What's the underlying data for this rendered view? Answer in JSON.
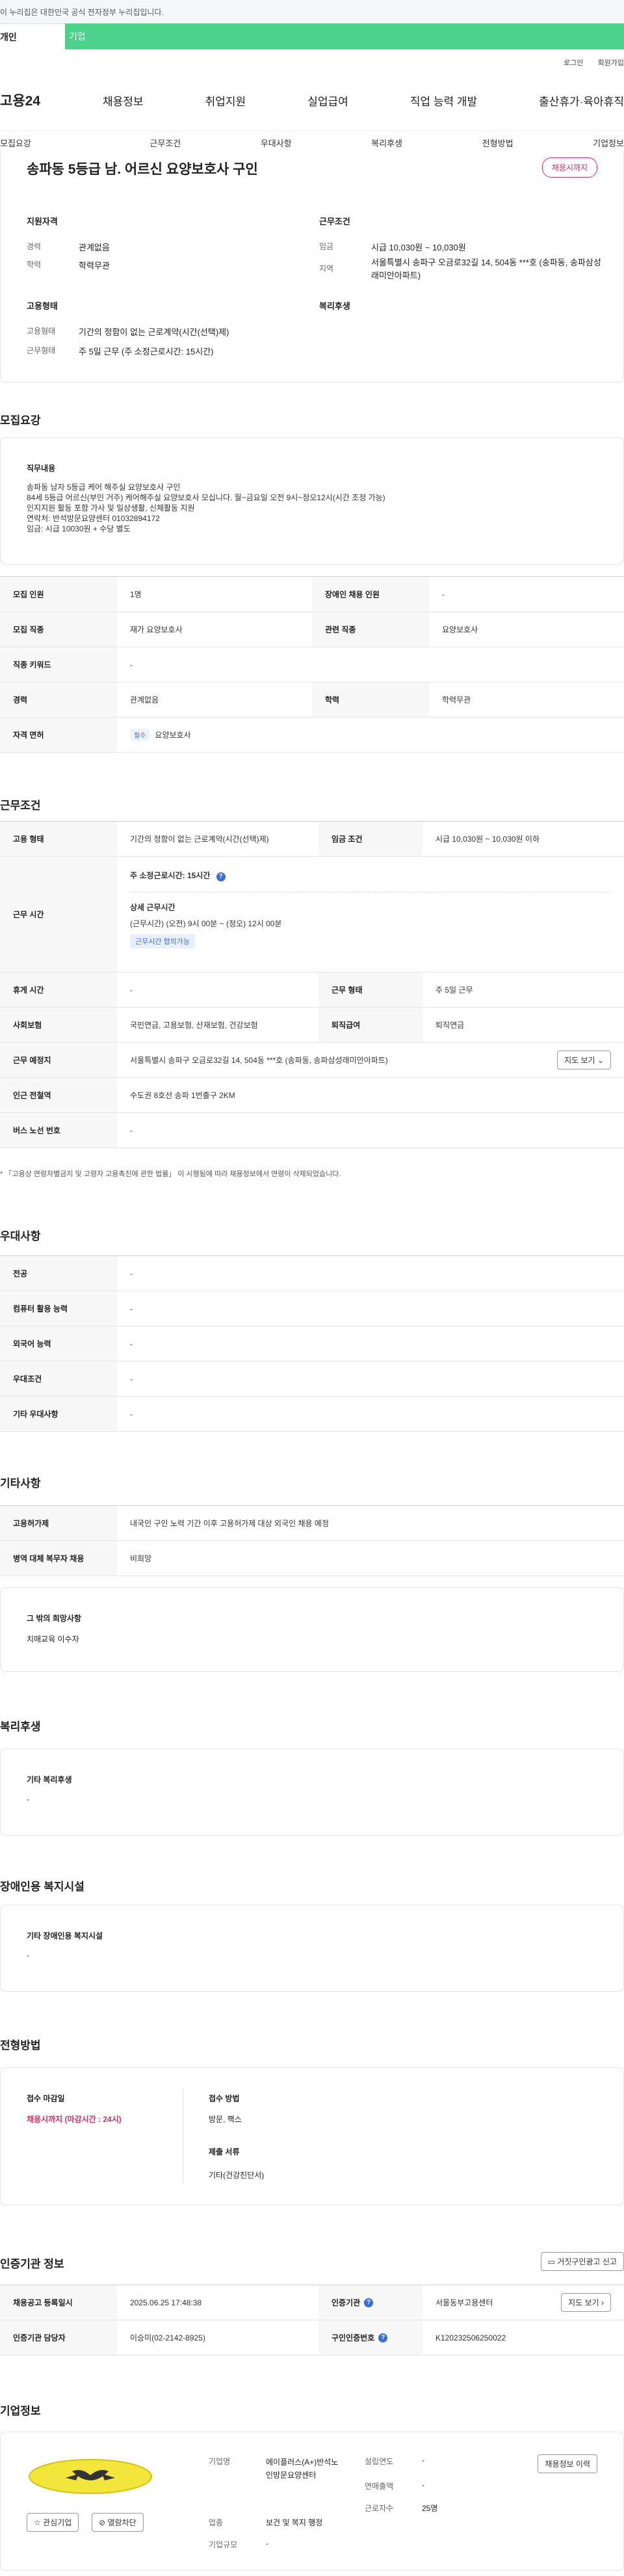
{
  "gov_notice": "이 누리집은 대한민국 공식 전자정부 누리집입니다.",
  "type_tabs": {
    "person": "개인",
    "company": "기업"
  },
  "top_links": [
    "로그인",
    "회원가입"
  ],
  "logo": "고용24",
  "main_menu": [
    "채용정보",
    "취업지원",
    "실업급여",
    "직업 능력 개발",
    "출산휴가·육아휴직"
  ],
  "sub_nav": [
    "모집요강",
    "근무조건",
    "우대사항",
    "복리후생",
    "전형방법",
    "기업정보"
  ],
  "job_title": "송파동 5등급 남. 어르신 요양보호사 구인",
  "status_badge": "채용시까지",
  "summary": {
    "qual_title": "지원자격",
    "career_label": "경력",
    "career_value": "관계없음",
    "edu_label": "학력",
    "edu_value": "학력무관",
    "work_title": "근무조건",
    "wage_label": "임금",
    "wage_value": "시급 10,030원 ~ 10,030원",
    "area_label": "지역",
    "area_value": "서울특별시 송파구 오금로32길 14, 504동 ***호 (송파동, 송파삼성래미안아파트)",
    "emp_title": "고용형태",
    "emp_type_label": "고용형태",
    "emp_type_value": "기간의 정함이 없는 근로계약(시간(선택)제)",
    "emp_form_label": "근무형태",
    "emp_form_value": "주 5일 근무 (주 소정근로시간: 15시간)",
    "welfare_title": "복리후생"
  },
  "recruit": {
    "title": "모집요강",
    "duty_title": "직무내용",
    "duty_lines": [
      "송파동 남자 5등급 케어 해주실 요양보호사 구인",
      "84세 5등급 어르신(부인 거주) 케어해주실 요양보호사 모십니다. 월~금요일 오전 9시~정오12시(시간 조정 가능)",
      "인지지원 활동 포함 가사 및 일상생활, 신체활동 지원",
      "연락처: 반석방문요양센터 01032894172",
      "임금: 시급 10030원 + 수당 별도"
    ],
    "rows": [
      {
        "l1": "모집 인원",
        "v1": "1명",
        "l2": "장애인 채용 인원",
        "v2": "-"
      },
      {
        "l1": "모집 직종",
        "v1": "재가 요양보호사",
        "l2": "관련 직종",
        "v2": "요양보호사"
      },
      {
        "l1": "직종 키워드",
        "v1": "-"
      },
      {
        "l1": "경력",
        "v1": "관계없음",
        "l2": "학력",
        "v2": "학력무관"
      }
    ],
    "license_label": "자격 면허",
    "license_tag": "필수",
    "license_value": "요양보호사"
  },
  "conditions": {
    "title": "근무조건",
    "emp_label": "고용 형태",
    "emp_value": "기간의 정함이 없는 근로계약(시간(선택)제)",
    "wage_label": "임금 조건",
    "wage_value": "시급 10,030원 ~ 10,030원 이하",
    "hours_label": "근무 시간",
    "weekly_hours": "주 소정근로시간: 15시간",
    "detail_title": "상세 근무시간",
    "detail_value": "(근무시간) (오전) 9시 00분 ~ (정오) 12시 00분",
    "negotiable_tag": "근무시간 협의가능",
    "rest_label": "휴게 시간",
    "rest_value": "-",
    "form_label": "근무 형태",
    "form_value": "주 5일 근무",
    "insurance_label": "사회보험",
    "insurance_value": "국민연금, 고용보험, 산재보험, 건강보험",
    "retire_label": "퇴직급여",
    "retire_value": "퇴직연금",
    "place_label": "근무 예정지",
    "place_value": "서울특별시 송파구 오금로32길 14, 504동 ***호 (송파동, 송파삼성래미안아파트)",
    "map_button": "지도 보기",
    "subway_label": "인근 전철역",
    "subway_value": "수도권 8호선 송파 1번출구 2KM",
    "bus_label": "버스 노선 번호",
    "bus_value": "-",
    "footnote": "* 「고용상 연령차별금지 및 고령자 고용촉진에 관한 법률」 이 시행됨에 따라 채용정보에서 연령이 삭제되었습니다."
  },
  "preference": {
    "title": "우대사항",
    "rows": [
      {
        "label": "전공",
        "value": "-"
      },
      {
        "label": "컴퓨터 활용 능력",
        "value": "-"
      },
      {
        "label": "외국어 능력",
        "value": "-"
      },
      {
        "label": "우대조건",
        "value": "-"
      },
      {
        "label": "기타 우대사항",
        "value": "-"
      }
    ]
  },
  "others": {
    "title": "기타사항",
    "rows": [
      {
        "label": "고용허가제",
        "value": "내국인 구인 노력 기간 이후 고용허가제 대상 외국인 채용 예정"
      },
      {
        "label": "병역 대체 복무자 채용",
        "value": "비희망"
      }
    ],
    "wish_title": "그 밖의 희망사항",
    "wish_value": "치매교육 이수자"
  },
  "welfare": {
    "title": "복리후생",
    "box_title": "기타 복리후생",
    "box_value": "-"
  },
  "disability": {
    "title": "장애인용 복지시설",
    "box_title": "기타 장애인용 복지시설",
    "box_value": "-"
  },
  "selection": {
    "title": "전형방법",
    "deadline_label": "접수 마감일",
    "deadline_value": "채용시까지 (마감시간 : 24시)",
    "method_label": "접수 방법",
    "method_value": "방문, 팩스",
    "docs_label": "제출 서류",
    "docs_value": "기타(건강진단서)"
  },
  "agency": {
    "title": "인증기관 정보",
    "report_button": "거짓구인광고 신고",
    "reg_label": "채용공고 등록일시",
    "reg_value": "2025.06.25 17:48:38",
    "org_label": "인증기관",
    "org_value": "서울동부고용센터",
    "map_button": "지도 보기",
    "manager_label": "인증기관 담당자",
    "manager_value": "이승미(02-2142-8925)",
    "cert_label": "구인인증번호",
    "cert_value": "K120232506250022"
  },
  "company": {
    "title": "기업정보",
    "fav_button": "관심기업",
    "block_button": "열람차단",
    "name_label": "기업명",
    "name_value": "에이플러스(A+)반석노인방문요양센터",
    "year_label": "설립연도",
    "year_value": "-",
    "sales_label": "연매출액",
    "sales_value": "-",
    "industry_label": "업종",
    "industry_value": "보건 및 복지 행정",
    "employees_label": "근로자수",
    "employees_value": "25명",
    "size_label": "기업규모",
    "size_value": "-",
    "jobs_button": "채용정보 이력"
  }
}
